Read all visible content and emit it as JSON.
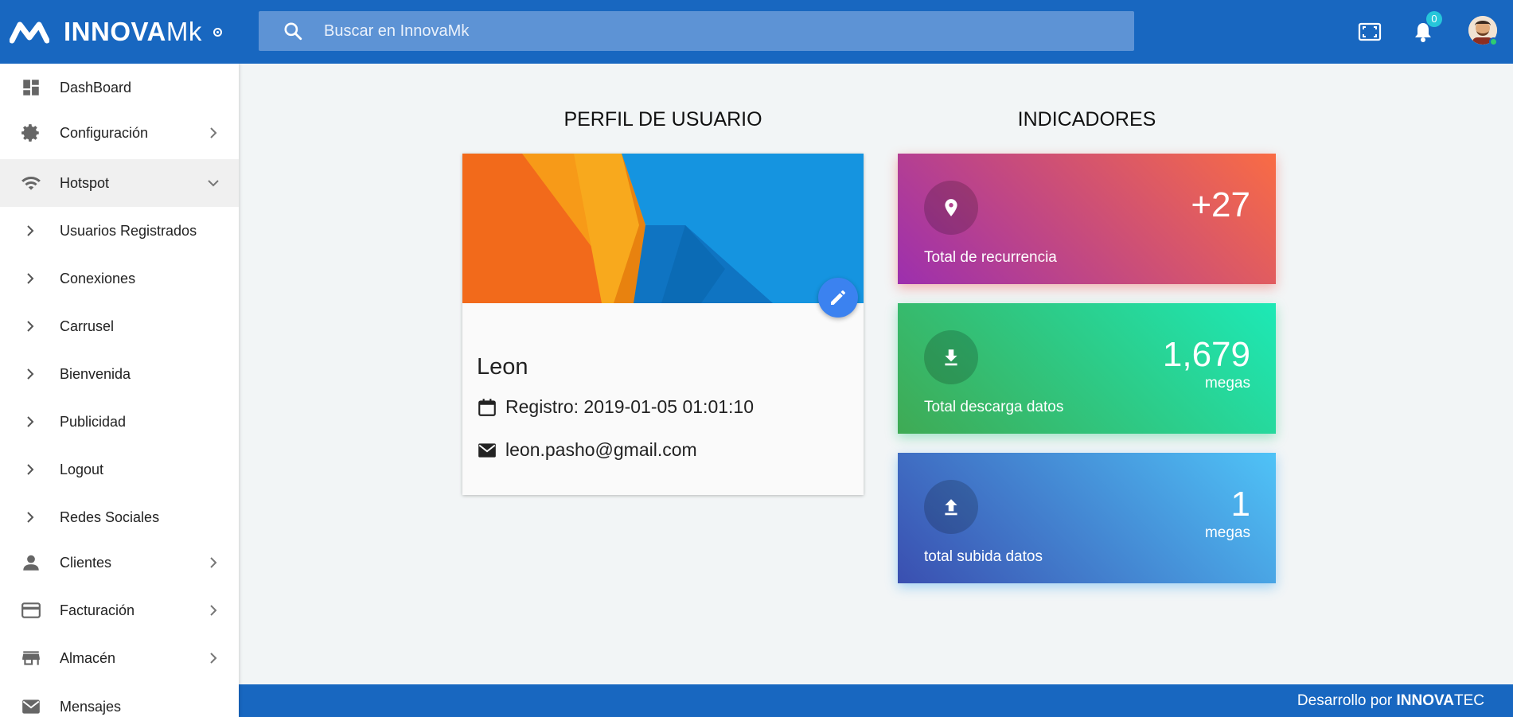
{
  "header": {
    "brand_bold": "INNOVA",
    "brand_rest": "Mk",
    "search_placeholder": "Buscar en InnovaMk",
    "notification_count": "0",
    "icons": [
      "menu-logo-icon",
      "search-icon",
      "fullscreen-icon",
      "bell-icon",
      "avatar"
    ]
  },
  "sidebar": {
    "items": [
      {
        "label": "DashBoard",
        "icon": "dashboard-icon"
      },
      {
        "label": "Configuración",
        "icon": "gear-icon"
      },
      {
        "label": "Hotspot",
        "icon": "wifi-icon"
      },
      {
        "label": "Usuarios Registrados",
        "icon": "chevron-right-icon"
      },
      {
        "label": "Conexiones",
        "icon": "chevron-right-icon"
      },
      {
        "label": "Carrusel",
        "icon": "chevron-right-icon"
      },
      {
        "label": "Bienvenida",
        "icon": "chevron-right-icon"
      },
      {
        "label": "Publicidad",
        "icon": "chevron-right-icon"
      },
      {
        "label": "Logout",
        "icon": "chevron-right-icon"
      },
      {
        "label": "Redes Sociales",
        "icon": "chevron-right-icon"
      },
      {
        "label": "Clientes",
        "icon": "person-icon"
      },
      {
        "label": "Facturación",
        "icon": "credit-card-icon"
      },
      {
        "label": "Almacén",
        "icon": "store-icon"
      },
      {
        "label": "Mensajes",
        "icon": "mail-icon"
      }
    ]
  },
  "profile": {
    "title": "PERFIL DE USUARIO",
    "name": "Leon",
    "registro": "Registro: 2019-01-05 01:01:10",
    "email": "leon.pasho@gmail.com"
  },
  "indicators": {
    "title": "INDICADORES",
    "cards": [
      {
        "value": "+27",
        "unit": "",
        "label": "Total de recurrencia",
        "icon": "location-pin-icon"
      },
      {
        "value": "1,679",
        "unit": "megas",
        "label": "Total descarga datos",
        "icon": "download-icon"
      },
      {
        "value": "1",
        "unit": "megas",
        "label": "total subida datos",
        "icon": "upload-icon"
      }
    ]
  },
  "footer": {
    "prefix": "Desarrollo por ",
    "brand_bold": "INNOVA",
    "brand_rest": "TEC"
  },
  "colors": {
    "primary": "#1867c0",
    "card1_from": "#9c2fae",
    "card1_to": "#f96c44",
    "card2_from": "#3faa54",
    "card2_to": "#1de9b6",
    "card3_from": "#3a4fb0",
    "card3_to": "#4fc3f7"
  }
}
